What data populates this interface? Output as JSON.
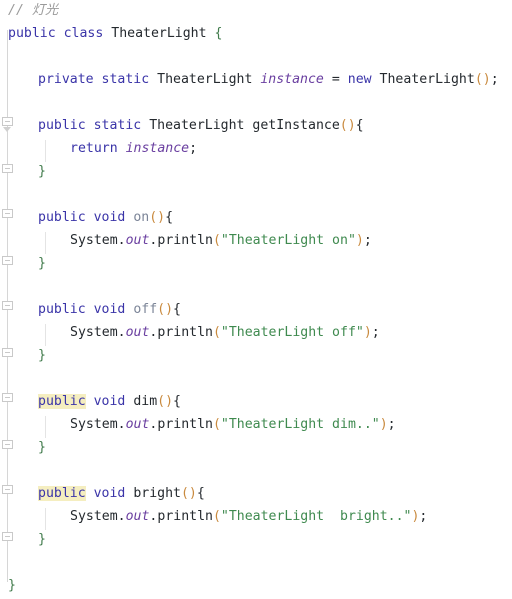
{
  "editor": {
    "language": "java",
    "colors": {
      "background": "#ffffff",
      "keyword": "#3a34a8",
      "string": "#3f8a4f",
      "comment": "#9a9a9a",
      "field": "#6a3fa0",
      "paren": "#c98a3e",
      "text": "#24292e",
      "highlight": "#f5eec0",
      "gutter_line": "#d6d6d6",
      "indent_guide": "#e4e4e4"
    }
  },
  "code": {
    "comment_line": "// 灯光",
    "comment_slashes": "// ",
    "comment_text": "灯光",
    "class_name": "TheaterLight",
    "class_decl": {
      "mod": "public",
      "kw": "class",
      "name": "TheaterLight",
      "brace": "{"
    },
    "field_decl": {
      "mod1": "private",
      "mod2": "static",
      "type": "TheaterLight",
      "name": "instance",
      "eq": "=",
      "new_kw": "new",
      "ctor": "TheaterLight",
      "parens": "()",
      "semi": ";"
    },
    "get_instance": {
      "mod1": "public",
      "mod2": "static",
      "type": "TheaterLight",
      "name": "getInstance",
      "parens": "()",
      "open_brace": "{",
      "return_kw": "return",
      "return_val": "instance",
      "semi": ";",
      "close_brace": "}"
    },
    "methods": [
      {
        "mod": "public",
        "mod_highlighted": false,
        "ret": "void",
        "name": "on",
        "name_style": "dim",
        "parens": "()",
        "open_brace": "{",
        "body_obj": "System",
        "body_dot1": ".",
        "body_field": "out",
        "body_dot2": ".",
        "body_call": "println",
        "body_open": "(",
        "body_string": "\"TheaterLight on\"",
        "body_close": ")",
        "body_semi": ";",
        "close_brace": "}"
      },
      {
        "mod": "public",
        "mod_highlighted": false,
        "ret": "void",
        "name": "off",
        "name_style": "dim",
        "parens": "()",
        "open_brace": "{",
        "body_obj": "System",
        "body_dot1": ".",
        "body_field": "out",
        "body_dot2": ".",
        "body_call": "println",
        "body_open": "(",
        "body_string": "\"TheaterLight off\"",
        "body_close": ")",
        "body_semi": ";",
        "close_brace": "}"
      },
      {
        "mod": "public",
        "mod_highlighted": true,
        "ret": "void",
        "name": "dim",
        "name_style": "normal",
        "parens": "()",
        "open_brace": "{",
        "body_obj": "System",
        "body_dot1": ".",
        "body_field": "out",
        "body_dot2": ".",
        "body_call": "println",
        "body_open": "(",
        "body_string": "\"TheaterLight dim..\"",
        "body_close": ")",
        "body_semi": ";",
        "close_brace": "}"
      },
      {
        "mod": "public",
        "mod_highlighted": true,
        "ret": "void",
        "name": "bright",
        "name_style": "normal",
        "parens": "()",
        "open_brace": "{",
        "body_obj": "System",
        "body_dot1": ".",
        "body_field": "out",
        "body_dot2": ".",
        "body_call": "println",
        "body_open": "(",
        "body_string": "\"TheaterLight  bright..\"",
        "body_close": ")",
        "body_semi": ";",
        "close_brace": "}"
      }
    ],
    "class_close_brace": "}"
  }
}
